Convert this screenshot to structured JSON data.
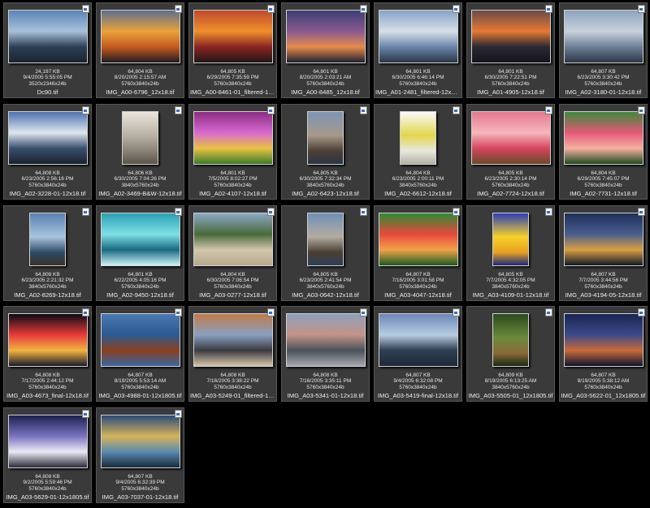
{
  "files": [
    {
      "name": "Dc90.tif",
      "size": "24,197 KB",
      "date": "9/4/2005 5:55:05 PM",
      "dims": "3520x2346x24b",
      "orientation": "landscape",
      "colors": [
        "#5c84b8",
        "#a9c1da",
        "#2d3f55",
        "#1a2430"
      ]
    },
    {
      "name": "IMG_A00-6796_12x18.tif",
      "size": "64,804 KB",
      "date": "8/20/2005 2:15:57 AM",
      "dims": "5760x3840x24b",
      "orientation": "landscape",
      "colors": [
        "#5d6f8e",
        "#e9a23b",
        "#c45a1e",
        "#221a22"
      ]
    },
    {
      "name": "IMG_A00-8461-01_filtered-12x18.tif",
      "size": "64,805 KB",
      "date": "6/29/2005 7:35:59 PM",
      "dims": "5760x3840x24b",
      "orientation": "landscape",
      "colors": [
        "#c04a2c",
        "#f0902c",
        "#8a2424",
        "#231515"
      ]
    },
    {
      "name": "IMG_A00-8485_12x18.tif",
      "size": "64,801 KB",
      "date": "8/20/2005 2:03:21 AM",
      "dims": "5760x3840x24b",
      "orientation": "landscape",
      "colors": [
        "#3b3d74",
        "#8a5a8e",
        "#e58b4c",
        "#202032"
      ]
    },
    {
      "name": "IMG_A01-2481_filtered-12x18.tif",
      "size": "64,801 KB",
      "date": "6/30/2005 6:46:14 PM",
      "dims": "5760x3840x24b",
      "orientation": "landscape",
      "colors": [
        "#86a4c8",
        "#d8dfe8",
        "#6a86aa",
        "#2a3648"
      ]
    },
    {
      "name": "IMG_A01-4905-12x18.tif",
      "size": "64,801 KB",
      "date": "6/30/2005 7:22:51 PM",
      "dims": "5760x3840x24b",
      "orientation": "landscape",
      "colors": [
        "#6a4a4a",
        "#e67a33",
        "#2a2833",
        "#141420"
      ]
    },
    {
      "name": "IMG_A02-3180-01-12x18.tif",
      "size": "64,807 KB",
      "date": "6/23/2005 3:30:42 PM",
      "dims": "5760x3840x24b",
      "orientation": "landscape",
      "colors": [
        "#8ea3bd",
        "#c9d2dc",
        "#6d7f97",
        "#2d3746"
      ]
    },
    {
      "name": "IMG_A02-3228-01-12x18.tif",
      "size": "64,808 KB",
      "date": "6/23/2005 2:56:16 PM",
      "dims": "5760x3840x24b",
      "orientation": "landscape",
      "colors": [
        "#4a72b0",
        "#dfe6ef",
        "#3a4f6e",
        "#1a222c"
      ]
    },
    {
      "name": "IMG_A02-3469-B&W-12x18.tif",
      "size": "64,806 KB",
      "date": "6/30/2005 7:04:26 PM",
      "dims": "3840x5760x24b",
      "orientation": "portrait",
      "colors": [
        "#e9e4dc",
        "#b9b2a5",
        "#8a8276",
        "#5a544c"
      ]
    },
    {
      "name": "IMG_A02-4107-12x18.tif",
      "size": "64,801 KB",
      "date": "7/5/2005 8:02:27 PM",
      "dims": "5760x3840x24b",
      "orientation": "landscape",
      "colors": [
        "#8b2c84",
        "#d86ad0",
        "#e7c341",
        "#3c7a2a"
      ]
    },
    {
      "name": "IMG_A02-6423-12x18.tif",
      "size": "64,805 KB",
      "date": "6/30/2005 7:32:34 PM",
      "dims": "3840x5760x24b",
      "orientation": "portrait",
      "colors": [
        "#7d96b4",
        "#a7998a",
        "#4e3f35",
        "#2a3644"
      ]
    },
    {
      "name": "IMG_A02-6612-12x18.tif",
      "size": "64,804 KB",
      "date": "6/23/2005 2:00:11 PM",
      "dims": "3840x5760x24b",
      "orientation": "portrait",
      "colors": [
        "#fafafa",
        "#e3d64c",
        "#e8e8e0",
        "#b4b0a4"
      ]
    },
    {
      "name": "IMG_A02-7724-12x18.tif",
      "size": "64,805 KB",
      "date": "6/23/2005 2:30:14 PM",
      "dims": "5760x3840x24b",
      "orientation": "landscape",
      "colors": [
        "#e67890",
        "#f6b6bc",
        "#d6455e",
        "#6a4a2a"
      ]
    },
    {
      "name": "IMG_A02-7731-12x18.tif",
      "size": "64,804 KB",
      "date": "6/29/2005 7:45:07 PM",
      "dims": "5760x3840x24b",
      "orientation": "landscape",
      "colors": [
        "#3c8a3a",
        "#e5597a",
        "#f4b1a0",
        "#1f4a20"
      ]
    },
    {
      "name": "IMG_A02-8269-12x18.tif",
      "size": "64,808 KB",
      "date": "6/23/2005 2:21:32 PM",
      "dims": "3840x5760x24b",
      "orientation": "portrait",
      "colors": [
        "#5a82b0",
        "#aac4de",
        "#2d4a66",
        "#3a3228"
      ]
    },
    {
      "name": "IMG_A02-9450-12x18.tif",
      "size": "64,801 KB",
      "date": "6/22/2005 4:05:16 PM",
      "dims": "5760x3840x24b",
      "orientation": "landscape",
      "colors": [
        "#2aa0b4",
        "#7fe0e6",
        "#1a6a82",
        "#cdf4f6"
      ]
    },
    {
      "name": "IMG_A03-0277-12x18.tif",
      "size": "64,804 KB",
      "date": "6/30/2005 7:06:54 PM",
      "dims": "5760x3840x24b",
      "orientation": "landscape",
      "colors": [
        "#8aa8c6",
        "#4a6a3a",
        "#d2c6ae",
        "#b7a88c"
      ]
    },
    {
      "name": "IMG_A03-0642-12x18.tif",
      "size": "64,805 KB",
      "date": "6/23/2005 2:41:54 PM",
      "dims": "3840x5760x24b",
      "orientation": "portrait",
      "colors": [
        "#6f8fb8",
        "#b4aca0",
        "#4a3e33",
        "#2d4058"
      ]
    },
    {
      "name": "IMG_A03-4047-12x18.tif",
      "size": "64,807 KB",
      "date": "7/16/2005 3:01:58 PM",
      "dims": "5760x3840x24b",
      "orientation": "landscape",
      "colors": [
        "#2e8a34",
        "#e8493e",
        "#f1a24a",
        "#1c5a22"
      ]
    },
    {
      "name": "IMG_A03-4109-01-12x18.tif",
      "size": "64,805 KB",
      "date": "7/7/2005 4:32:05 PM",
      "dims": "3840x5760x24b",
      "orientation": "portrait",
      "colors": [
        "#2c3eb8",
        "#f6d22a",
        "#e8a020",
        "#1a2680"
      ]
    },
    {
      "name": "IMG_A03-4194-05-12x18.tif",
      "size": "64,807 KB",
      "date": "7/7/2005 3:44:56 PM",
      "dims": "5760x3840x24b",
      "orientation": "landscape",
      "colors": [
        "#1f2f5a",
        "#4a5e8e",
        "#d9a040",
        "#101828"
      ]
    },
    {
      "name": "IMG_A03-4673_final-12x18.tif",
      "size": "64,808 KB",
      "date": "7/17/2005 2:44:12 PM",
      "dims": "5760x3840x24b",
      "orientation": "landscape",
      "colors": [
        "#0a0a14",
        "#e83a3a",
        "#f2b440",
        "#1a1a2a"
      ]
    },
    {
      "name": "IMG_A03-4988-01-12x1805.tif",
      "size": "64,807 KB",
      "date": "8/19/2005 5:53:14 AM",
      "dims": "5760x3840x24b",
      "orientation": "landscape",
      "colors": [
        "#4a78b0",
        "#2a5a92",
        "#8a4020",
        "#3a66a0"
      ]
    },
    {
      "name": "IMG_A03-5249-01_filtered-12x18.tif",
      "size": "64,808 KB",
      "date": "7/16/2005 3:38:22 PM",
      "dims": "5760x3840x24b",
      "orientation": "landscape",
      "colors": [
        "#c07a4a",
        "#8aa0c0",
        "#3a3a40",
        "#d6c6a8"
      ]
    },
    {
      "name": "IMG_A03-5341-01-12x18.tif",
      "size": "64,808 KB",
      "date": "7/16/2005 3:35:11 PM",
      "dims": "5760x3840x24b",
      "orientation": "landscape",
      "colors": [
        "#8ea0bc",
        "#c49488",
        "#4a505a",
        "#a5a8ae"
      ]
    },
    {
      "name": "IMG_A03-5419-final-12x18.tif",
      "size": "64,807 KB",
      "date": "9/4/2005 6:32:08 PM",
      "dims": "5760x3840x24b",
      "orientation": "landscape",
      "colors": [
        "#6a88b6",
        "#b8cce2",
        "#2f3e52",
        "#1e2a38"
      ]
    },
    {
      "name": "IMG_A03-5505-01_12x1805.tif",
      "size": "64,809 KB",
      "date": "8/19/2005 6:13:25 AM",
      "dims": "3840x5760x24b",
      "orientation": "portrait",
      "colors": [
        "#2c4a1e",
        "#6a8a3a",
        "#8a6a3a",
        "#1a2a12"
      ]
    },
    {
      "name": "IMG_A03-5622-01_12x1805.tif",
      "size": "64,807 KB",
      "date": "8/19/2005 5:38:12 AM",
      "dims": "5760x3840x24b",
      "orientation": "landscape",
      "colors": [
        "#1a2450",
        "#3c4a8a",
        "#c86a3a",
        "#0e1430"
      ]
    },
    {
      "name": "IMG_A03-5629-01-12x1805.tif",
      "size": "64,808 KB",
      "date": "9/2/2005 5:59:46 PM",
      "dims": "5760x3840x24b",
      "orientation": "landscape",
      "colors": [
        "#1c2050",
        "#7a74c0",
        "#eaeaf4",
        "#2a2a3a"
      ]
    },
    {
      "name": "IMG_A03-7037-01-12x18.tif",
      "size": "64,807 KB",
      "date": "9/4/2005 6:32:39 PM",
      "dims": "5760x3840x24b",
      "orientation": "landscape",
      "colors": [
        "#2a4a7a",
        "#d6b45a",
        "#5a8ab0",
        "#1a2a3a"
      ]
    }
  ]
}
